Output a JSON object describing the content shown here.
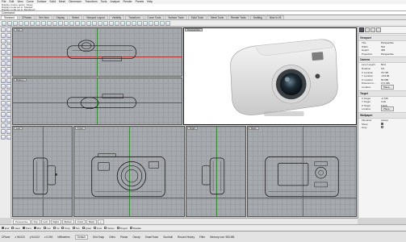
{
  "menu": [
    "File",
    "Edit",
    "View",
    "Curve",
    "Surface",
    "Solid",
    "Mesh",
    "Dimension",
    "Transform",
    "Tools",
    "Analyze",
    "Render",
    "Panels",
    "Help"
  ],
  "command_history": [
    "Display restore option: Reset",
    "Display mode set to 'Shaded'",
    "Display mode set to 'Rendered'"
  ],
  "command_prompt": "Command:",
  "toolbar_tabs": [
    "Standard",
    "CPlanes",
    "Set View",
    "Display",
    "Select",
    "Viewport Layout",
    "Visibility",
    "Transform",
    "Curve Tools",
    "Surface Tools",
    "Solid Tools",
    "Mesh Tools",
    "Render Tools",
    "Drafting",
    "New in V6"
  ],
  "active_toolbar_tab": "Standard",
  "viewports": {
    "top": {
      "title": "Top"
    },
    "bottom": {
      "title": "Bottom"
    },
    "perspective": {
      "title": "Perspective"
    },
    "left": {
      "title": "Left"
    },
    "front": {
      "title": "Front"
    },
    "right": {
      "title": "Right"
    },
    "back": {
      "title": "Back"
    }
  },
  "properties": {
    "viewport_section": "Viewport",
    "viewport_rows": [
      {
        "k": "Title",
        "v": "Perspective"
      },
      {
        "k": "Width",
        "v": "512"
      },
      {
        "k": "Height",
        "v": "406"
      },
      {
        "k": "Projection",
        "v": "Perspective"
      }
    ],
    "camera_section": "Camera",
    "camera_rows": [
      {
        "k": "Lens Length",
        "v": "50.0"
      },
      {
        "k": "Rotation",
        "v": "0.0"
      },
      {
        "k": "X Location",
        "v": "76.725"
      },
      {
        "k": "Y Location",
        "v": "-143.09"
      },
      {
        "k": "Z Location",
        "v": "54.695"
      },
      {
        "k": "Distance to...",
        "v": "171.436"
      },
      {
        "k": "Location",
        "v": "Place..."
      }
    ],
    "target_section": "Target",
    "target_rows": [
      {
        "k": "X Target",
        "v": "-2.736"
      },
      {
        "k": "Y Target",
        "v": "4.19"
      },
      {
        "k": "Z Target",
        "v": "6.916"
      },
      {
        "k": "Location",
        "v": "Place..."
      }
    ],
    "wallpaper_section": "Wallpaper",
    "wallpaper_rows": [
      {
        "k": "Filename",
        "v": "(none)"
      },
      {
        "k": "Show",
        "v": ""
      },
      {
        "k": "Gray",
        "v": ""
      }
    ]
  },
  "viewport_tabs": [
    "Perspective",
    "Top",
    "Left",
    "Right",
    "Bottom",
    "Front",
    "Back"
  ],
  "active_viewport_tab": "Perspective",
  "osnaps": [
    {
      "label": "End",
      "on": true
    },
    {
      "label": "Near",
      "on": false
    },
    {
      "label": "Point",
      "on": true
    },
    {
      "label": "Mid",
      "on": true
    },
    {
      "label": "Cen",
      "on": false
    },
    {
      "label": "Int",
      "on": false
    },
    {
      "label": "Perp",
      "on": false
    },
    {
      "label": "Tan",
      "on": false
    },
    {
      "label": "Quad",
      "on": false
    },
    {
      "label": "Knot",
      "on": false
    },
    {
      "label": "Vertex",
      "on": false
    },
    {
      "label": "Project",
      "on": false
    },
    {
      "label": "Disable",
      "on": false
    }
  ],
  "status": {
    "cplane": "CPlane",
    "x": "x 96.023",
    "y": "y 54.513",
    "z": "z 0.000",
    "units": "Millimeters",
    "layer": "Default",
    "items": [
      "Grid Snap",
      "Ortho",
      "Planar",
      "Osnap",
      "SmartTrack",
      "Gumball",
      "Record History",
      "Filter",
      "Memory use: 983 MB"
    ]
  }
}
